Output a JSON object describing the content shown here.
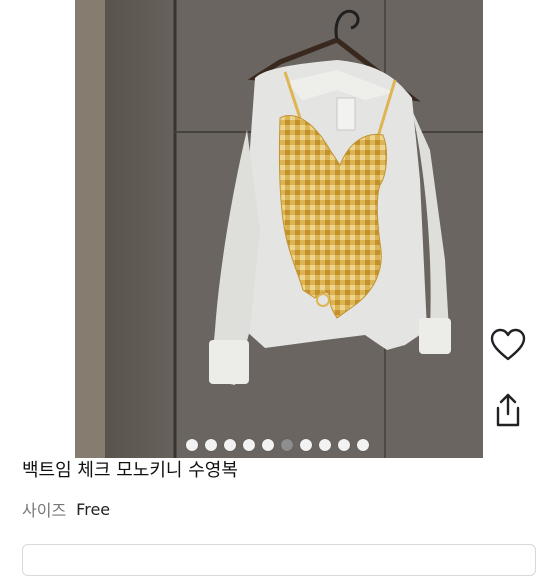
{
  "product": {
    "title": "백트임 체크 모노키니 수영복",
    "size_label": "사이즈",
    "size_value": "Free"
  },
  "carousel": {
    "dot_count": 10,
    "active_index": 5
  },
  "icons": {
    "like": "heart-icon",
    "share": "share-icon"
  },
  "colors": {
    "swimsuit": "#e6bb55",
    "shirt": "#eeeeea",
    "wall": "#6f6a64"
  }
}
